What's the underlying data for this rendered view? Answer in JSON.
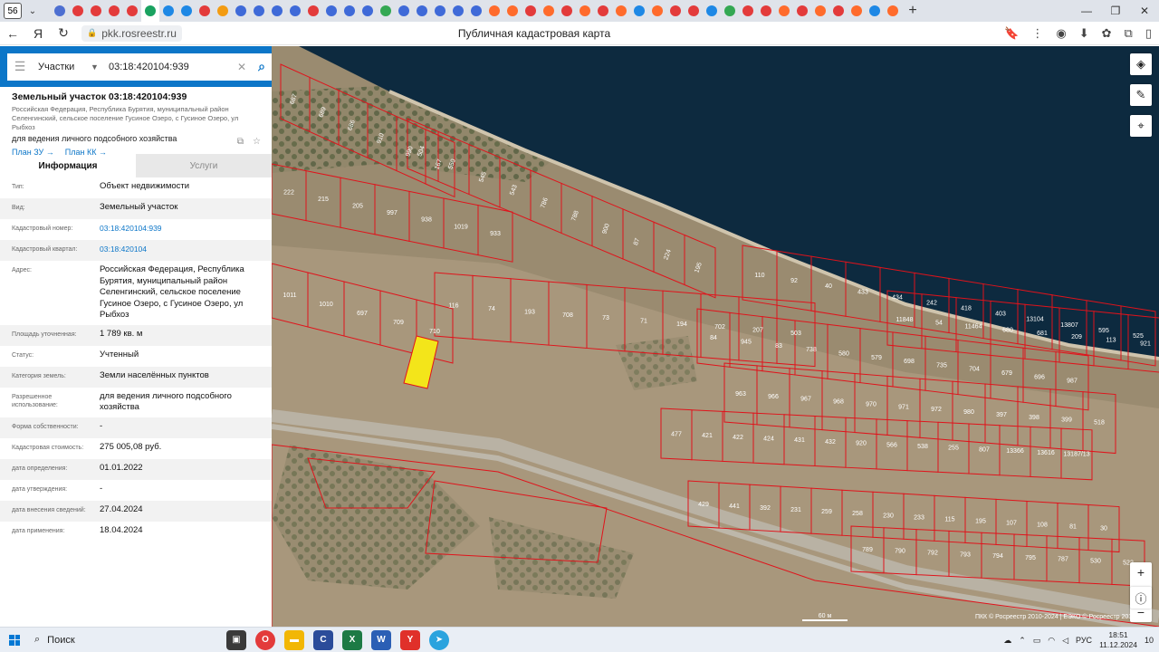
{
  "browser": {
    "tab_count": "56",
    "page_title": "Публичная кадастровая карта",
    "domain": "pkk.rosreestr.ru",
    "favicon_colors": [
      "#4d6fd1",
      "#e33b3b",
      "#e33b3b",
      "#e33b3b",
      "#e33b3b",
      "#1aa260",
      "#1e88e5",
      "#1e88e5",
      "#e33b3b",
      "#f39c12",
      "#3f6ad8",
      "#3f6ad8",
      "#3f6ad8",
      "#3f6ad8",
      "#e33b3b",
      "#3f6ad8",
      "#3f6ad8",
      "#3f6ad8",
      "#34a853",
      "#3f6ad8",
      "#3f6ad8",
      "#3f6ad8",
      "#3f6ad8",
      "#3f6ad8",
      "#ff6b2c",
      "#ff6b2c",
      "#e33b3b",
      "#ff6b2c",
      "#e33b3b",
      "#ff6b2c",
      "#e33b3b",
      "#ff6b2c",
      "#1e88e5",
      "#ff6b2c",
      "#e33b3b",
      "#e33b3b",
      "#1e88e5",
      "#34a853",
      "#e33b3b",
      "#e33b3b",
      "#ff6b2c",
      "#e33b3b",
      "#ff6b2c",
      "#e33b3b",
      "#ff6b2c",
      "#1e88e5",
      "#ff6b2c"
    ]
  },
  "search": {
    "category": "Участки",
    "query": "03:18:420104:939"
  },
  "object": {
    "title": "Земельный участок 03:18:420104:939",
    "address_short": "Российская Федерация, Республика Бурятия, муниципальный район Селенгинский, сельское поселение Гусиное Озеро, с Гусиное Озеро, ул Рыбхоз",
    "use": "для ведения личного подсобного хозяйства",
    "link_plan_zu": "План ЗУ →",
    "link_plan_kk": "План КК →"
  },
  "tabs": {
    "info": "Информация",
    "services": "Услуги"
  },
  "rows": [
    {
      "k": "Тип:",
      "v": "Объект недвижимости"
    },
    {
      "k": "Вид:",
      "v": "Земельный участок"
    },
    {
      "k": "Кадастровый номер:",
      "v": "03:18:420104:939"
    },
    {
      "k": "Кадастровый квартал:",
      "v": "03:18:420104"
    },
    {
      "k": "Адрес:",
      "v": "Российская Федерация, Республика Бурятия, муниципальный район Селенгинский, сельское поселение Гусиное Озеро, с Гусиное Озеро, ул Рыбхоз"
    },
    {
      "k": "Площадь уточненная:",
      "v": "1 789 кв. м"
    },
    {
      "k": "Статус:",
      "v": "Учтенный"
    },
    {
      "k": "Категория земель:",
      "v": "Земли населённых пунктов"
    },
    {
      "k": "Разрешенное использование:",
      "v": "для ведения личного подсобного хозяйства"
    },
    {
      "k": "Форма собственности:",
      "v": "-"
    },
    {
      "k": "Кадастровая стоимость:",
      "v": "275 005,08 руб."
    },
    {
      "k": "дата определения:",
      "v": "01.01.2022"
    },
    {
      "k": "дата утверждения:",
      "v": "-"
    },
    {
      "k": "дата внесения сведений:",
      "v": "27.04.2024"
    },
    {
      "k": "дата применения:",
      "v": "18.04.2024"
    }
  ],
  "map": {
    "scale": "60 м",
    "copyright": "ПКК © Росреестр 2010-2024 | ЕЭКО © Росреестр 2019-2024",
    "parcel_color": "#e0131b",
    "selected_color": "#f3e51a",
    "water_color": "#0d2a3f",
    "parcel_labels": [
      "687",
      "689",
      "686",
      "910",
      "990",
      "167",
      "222",
      "215",
      "205",
      "997",
      "938",
      "1019",
      "933",
      "1011",
      "1010",
      "697",
      "709",
      "710",
      "116",
      "74",
      "193",
      "708",
      "73",
      "71",
      "194",
      "702",
      "207",
      "503",
      "504",
      "550",
      "545",
      "543",
      "786",
      "788",
      "900",
      "87",
      "224",
      "195",
      "84",
      "945",
      "83",
      "738",
      "580",
      "579",
      "698",
      "735",
      "704",
      "679",
      "696",
      "987",
      "963",
      "966",
      "967",
      "968",
      "970",
      "971",
      "972",
      "980",
      "397",
      "398",
      "399",
      "518",
      "477",
      "421",
      "422",
      "424",
      "431",
      "432",
      "920",
      "566",
      "538",
      "255",
      "807",
      "13366",
      "13616",
      "13187/13",
      "429",
      "441",
      "392",
      "231",
      "259",
      "258",
      "230",
      "233",
      "115",
      "195",
      "107",
      "108",
      "81",
      "30",
      "789",
      "790",
      "792",
      "793",
      "794",
      "795",
      "787",
      "530",
      "522",
      "110",
      "92",
      "40",
      "433",
      "434",
      "242",
      "418",
      "403",
      "13104",
      "13807",
      "595",
      "525",
      "11848",
      "54",
      "11464",
      "680",
      "681",
      "209",
      "113",
      "921",
      "1"
    ]
  },
  "taskbar": {
    "search": "Поиск",
    "lang": "РУС",
    "time": "18:51",
    "date": "11.12.2024",
    "notif": "10"
  }
}
